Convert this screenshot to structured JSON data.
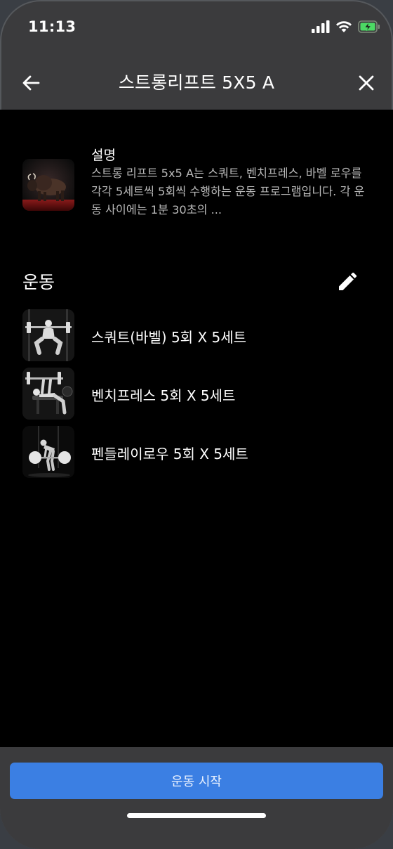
{
  "status": {
    "time": "11:13",
    "icons": [
      "signal-icon",
      "wifi-icon",
      "battery-charging-icon"
    ]
  },
  "nav": {
    "title": "스트롱리프트 5X5 A",
    "back_icon": "arrow-left-icon",
    "close_icon": "close-icon"
  },
  "description": {
    "title": "설명",
    "text": "스트롱 리프트 5x5 A는 스쿼트, 벤치프레스, 바벨 로우를 각각 5세트씩 5회씩 수행하는 운동 프로그램입니다. 각 운동 사이에는 1분 30초의 ..."
  },
  "exercises_section": {
    "title": "운동",
    "edit_icon": "pencil-icon",
    "items": [
      {
        "label": "스쿼트(바벨) 5회 X 5세트"
      },
      {
        "label": "벤치프레스 5회 X 5세트"
      },
      {
        "label": "펜들레이로우 5회 X 5세트"
      }
    ]
  },
  "start_button": {
    "label": "운동 시작"
  },
  "colors": {
    "accent": "#3b7fe3",
    "background": "#000000",
    "chrome": "#3b3b3d"
  }
}
